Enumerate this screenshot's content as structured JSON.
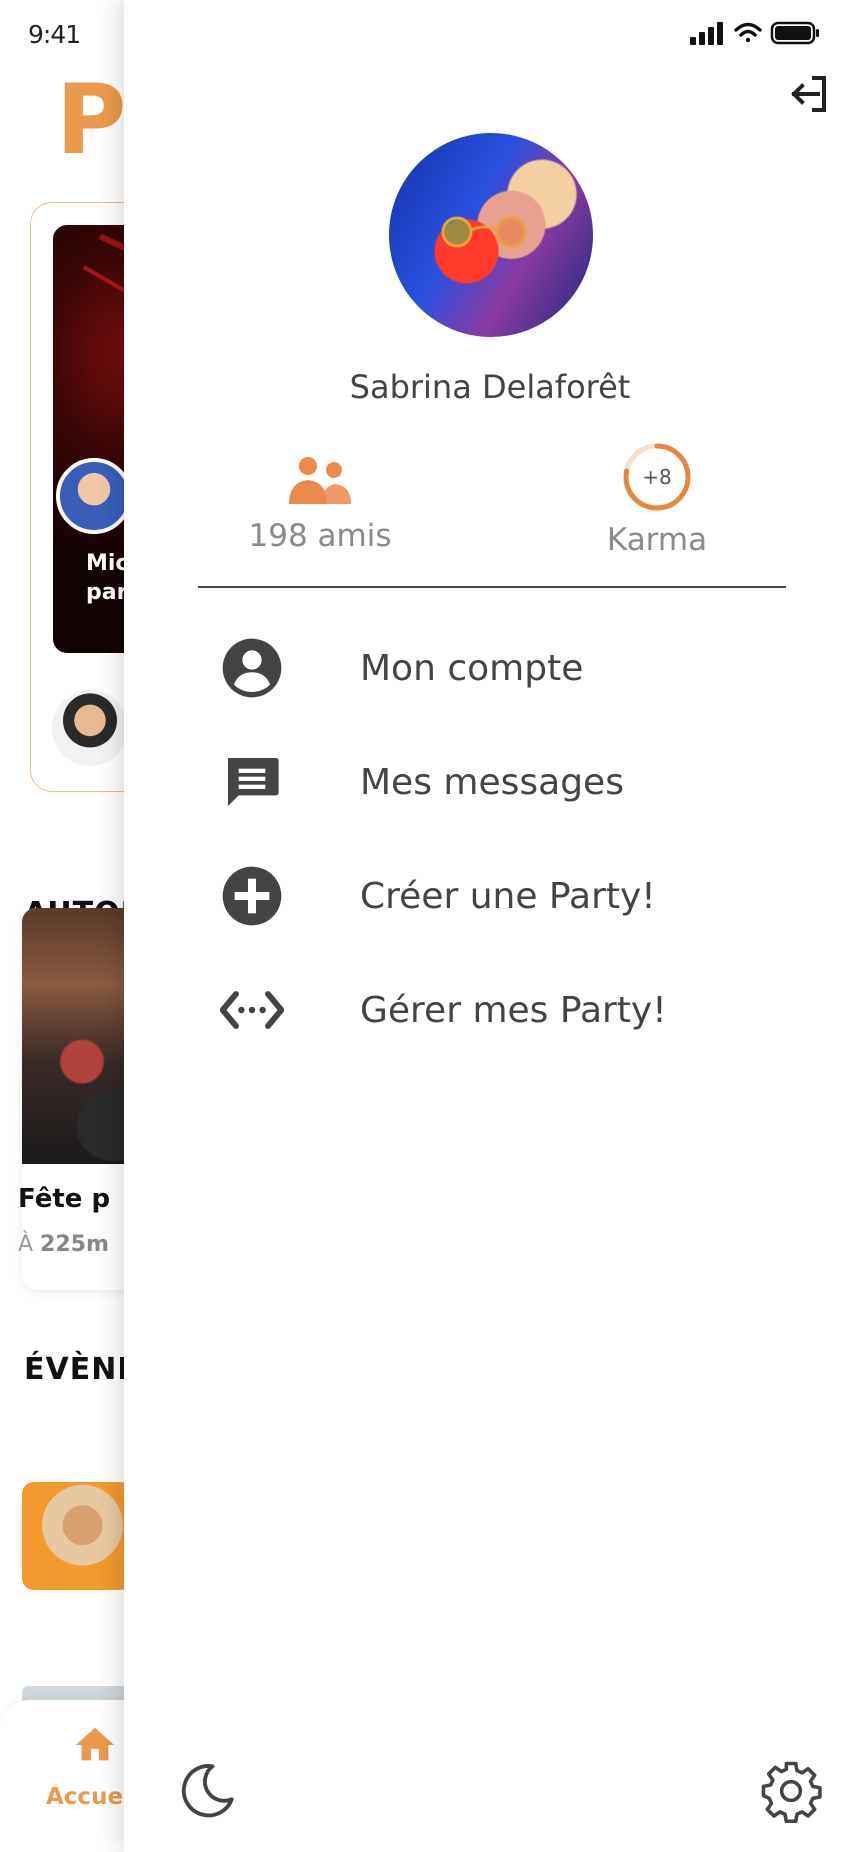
{
  "status_bar": {
    "time": "9:41"
  },
  "background": {
    "brand_partial": "Pa",
    "hero_text": "Mic\npar",
    "section_nearby": "AUTOUR",
    "card_title": "Fête p",
    "card_distance_prefix": "À ",
    "card_distance_value": "225m",
    "section_events": "ÉVÈNE",
    "nav_home_label": "Accue"
  },
  "drawer": {
    "profile": {
      "name": "Sabrina Delaforêt"
    },
    "stats": {
      "friends_label": "198 amis",
      "karma_value": "+8",
      "karma_label": "Karma",
      "karma_progress": 0.78
    },
    "menu": [
      {
        "label": "Mon compte",
        "icon": "account-circle-icon"
      },
      {
        "label": "Mes messages",
        "icon": "message-icon"
      },
      {
        "label": "Créer une Party!",
        "icon": "add-circle-icon"
      },
      {
        "label": "Gérer mes Party!",
        "icon": "code-arrows-icon"
      }
    ]
  },
  "colors": {
    "accent": "#EB9A4D",
    "text_dark": "#444444",
    "text_muted": "#8a8a8a",
    "icon_dark": "#444444"
  }
}
